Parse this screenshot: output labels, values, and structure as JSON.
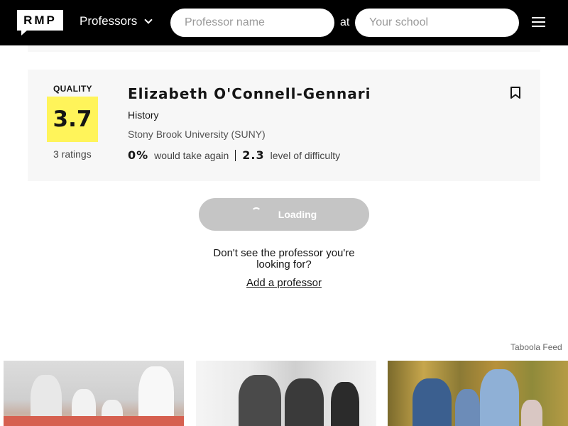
{
  "header": {
    "logo_text": "RMP",
    "search_type": "Professors",
    "professor_placeholder": "Professor name",
    "at_label": "at",
    "school_placeholder": "Your school"
  },
  "card": {
    "quality_label": "QUALITY",
    "quality_score": "3.7",
    "ratings_count": "3 ratings",
    "name": "Elizabeth O'Connell-Gennari",
    "department": "History",
    "school": "Stony Brook University (SUNY)",
    "take_again_value": "0%",
    "take_again_label": "would take again",
    "difficulty_value": "2.3",
    "difficulty_label": "level of difficulty"
  },
  "loading_label": "Loading",
  "not_found_text": "Don't see the professor you're looking for?",
  "add_professor_link": "Add a professor",
  "taboola_label": "Taboola Feed",
  "colors": {
    "header_bg": "#000000",
    "quality_bg": "#fff45a",
    "card_bg": "#f7f7f7"
  }
}
